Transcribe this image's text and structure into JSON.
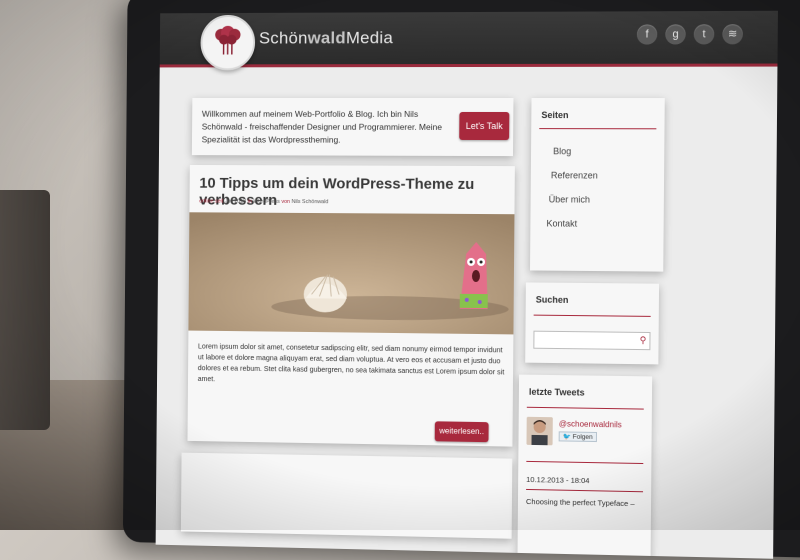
{
  "site": {
    "brand_light": "Schön",
    "brand_bold": "wald",
    "brand_tail": "Media",
    "social": [
      {
        "name": "facebook-icon",
        "glyph": "f"
      },
      {
        "name": "google-plus-icon",
        "glyph": "g"
      },
      {
        "name": "twitter-icon",
        "glyph": "t"
      },
      {
        "name": "rss-icon",
        "glyph": "≋"
      }
    ],
    "accent": "#a8293d"
  },
  "welcome": {
    "text": "Willkommen auf meinem Web-Portfolio & Blog. Ich bin Nils Schönwald - freischaffender Designer und Programmierer. Meine Spezialität ist das Wordpresstheming.",
    "cta": "Let's Talk"
  },
  "post": {
    "title": "10 Tipps um dein WordPress-Theme zu verbessern",
    "meta": {
      "status": "online seit",
      "date": "Juli 2013",
      "in": "in",
      "category": "WordPress",
      "von": "von",
      "author": "Nils Schönwald"
    },
    "body": "Lorem ipsum dolor sit amet, consetetur sadipscing elitr, sed diam nonumy eirmod tempor invidunt ut labore et dolore magna aliquyam erat, sed diam voluptua. At vero eos et accusam et justo duo dolores et ea rebum. Stet clita kasd gubergren, no sea takimata sanctus est Lorem ipsum dolor sit amet.",
    "read_more": "weiterlesen.."
  },
  "sidebar": {
    "pages_title": "Seiten",
    "pages": [
      "Blog",
      "Referenzen",
      "Über mich",
      "Kontakt"
    ],
    "search_title": "Suchen",
    "search_placeholder": "",
    "tweets_title": "letzte Tweets",
    "tweet_handle": "@schoenwaldnils",
    "follow_label": "Folgen",
    "tweet_date": "10.12.2013 - 18:04",
    "tweet_text": "Choosing the perfect Typeface –"
  }
}
